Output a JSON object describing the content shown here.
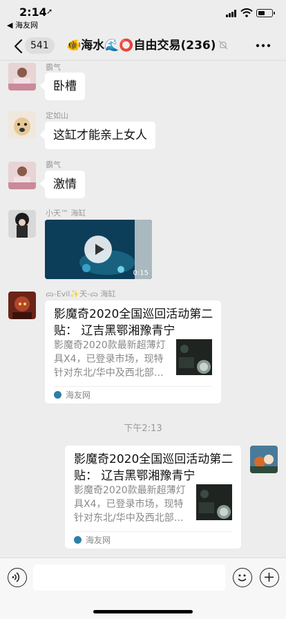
{
  "status_bar": {
    "time": "2:14",
    "back_app": "◀ 海友网"
  },
  "nav": {
    "unread_count": "541",
    "title": "🐠海水🌊⭕自由交易(236)"
  },
  "messages": [
    {
      "sender": "霸气",
      "text": "卧槽"
    },
    {
      "sender": "定如山",
      "text": "这缸才能亲上女人"
    },
    {
      "sender": "霸气",
      "text": "激情"
    },
    {
      "sender": "小天™ 海缸",
      "video_duration": "0:15"
    },
    {
      "sender": "ᯅ-Evil✨天-ᯅ 海缸",
      "card": {
        "title": "影魔奇2020全国巡回活动第二贴： 辽吉黑鄂湘豫青宁",
        "desc": "影魔奇2020款最新超薄灯具X4，已登录市场，现特针对东北/华中及西北部…",
        "source": "海友网"
      }
    }
  ],
  "timestamp": "下午2:13",
  "my_message": {
    "card": {
      "title": "影魔奇2020全国巡回活动第二贴： 辽吉黑鄂湘豫青宁",
      "desc": "影魔奇2020款最新超薄灯具X4，已登录市场，现特针对东北/华中及西北部…",
      "source": "海友网"
    }
  },
  "input": {
    "placeholder": ""
  },
  "colors": {
    "background": "#ededed",
    "bubble": "#ffffff",
    "muted_text": "#9a9a9a"
  },
  "icons": [
    "location-arrow-icon",
    "signal-icon",
    "wifi-icon",
    "battery-icon",
    "back-chevron-icon",
    "mute-icon",
    "more-icon",
    "play-icon",
    "voice-icon",
    "emoji-icon",
    "plus-icon"
  ]
}
